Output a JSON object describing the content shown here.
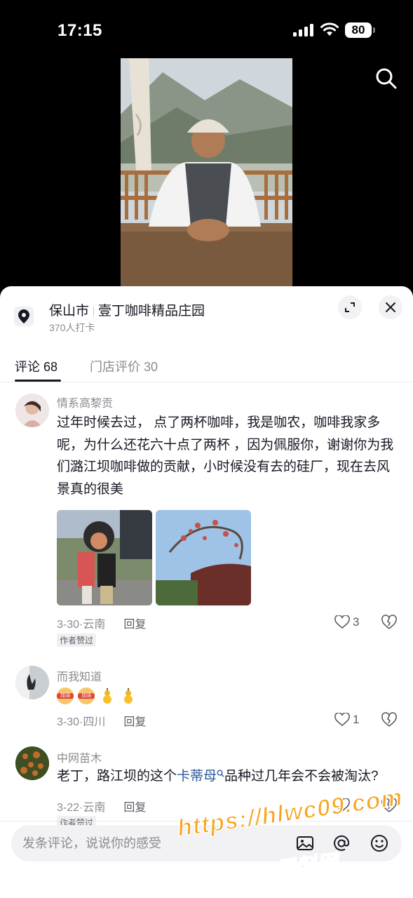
{
  "status_bar": {
    "time": "17:15",
    "battery": "80"
  },
  "location": {
    "city": "保山市",
    "place": "壹丁咖啡精品庄园",
    "checkins": "370人打卡"
  },
  "tabs": [
    {
      "label": "评论 68",
      "active": true
    },
    {
      "label": "门店评价 30",
      "active": false
    }
  ],
  "comments": [
    {
      "user": "情系高黎贡",
      "text": "过年时候去过， 点了两杯咖啡，我是咖农，咖啡我家多呢，为什么还花六十点了两杯 ，因为佩服你，谢谢你为我们潞江坝咖啡做的贡献，小时候没有去的硅厂，现在去风景真的很美",
      "date": "3-30",
      "region": "云南",
      "reply": "回复",
      "likes": "3",
      "badge": "作者赞过"
    },
    {
      "user": "而我知道",
      "emoji_1": "加油",
      "emoji_2": "加油",
      "date": "3-30",
      "region": "四川",
      "reply": "回复",
      "likes": "1"
    },
    {
      "user": "中网苗木",
      "text_before": "老丁，路江坝的这个",
      "text_link": "卡蒂母",
      "text_after": "品种过几年会不会被淘汰?",
      "date": "3-22",
      "region": "云南",
      "reply": "回复",
      "likes": "1",
      "badge": "作者赞过"
    }
  ],
  "input": {
    "placeholder": "发条评论，说说你的感受"
  },
  "watermark": {
    "line1": "https://hlwc09.com",
    "line2": "黑料网"
  },
  "icons": {
    "search": "search-icon",
    "location": "location-pin-icon",
    "expand": "expand-icon",
    "close": "close-icon",
    "like": "heart-icon",
    "dislike": "broken-heart-icon",
    "image": "image-icon",
    "mention": "at-icon",
    "emoji": "emoji-icon"
  },
  "colors": {
    "link": "#2f5a9e",
    "watermark": "#f7a51e",
    "text": "#161823",
    "muted": "#8a8b91"
  }
}
